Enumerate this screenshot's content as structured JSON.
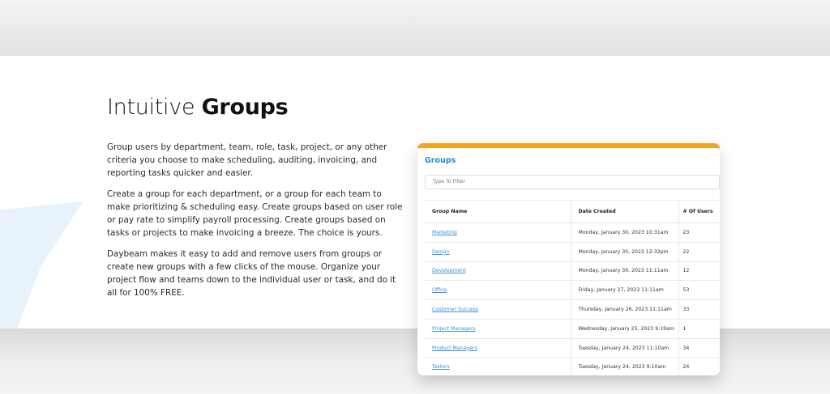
{
  "heading": {
    "light": "Intuitive",
    "bold": "Groups"
  },
  "paragraphs": [
    "Group users by department, team, role, task, project, or any other criteria you choose to make scheduling, auditing, invoicing, and reporting tasks quicker and easier.",
    "Create a group for each department, or a group for each team to make prioritizing & scheduling easy. Create groups based on user role or pay rate to simplify payroll processing. Create groups based on tasks or projects to make invoicing a breeze. The choice is yours.",
    "Daybeam makes it easy to add and remove users from groups or create new groups with a few clicks of the mouse. Organize your project flow and teams down to the individual user or task, and do it all for 100% FREE."
  ],
  "panel": {
    "title": "Groups",
    "filter_placeholder": "Type To Filter",
    "columns": [
      "Group Name",
      "Date Created",
      "# Of Users"
    ],
    "rows": [
      {
        "name": "Marketing",
        "date": "Monday, January 30, 2023 10:31am",
        "users": "23"
      },
      {
        "name": "Design",
        "date": "Monday, January 30, 2023 12:32pm",
        "users": "22"
      },
      {
        "name": "Development",
        "date": "Monday, January 30, 2023 11:11am",
        "users": "12"
      },
      {
        "name": "Office",
        "date": "Friday, January 27, 2023 11:11am",
        "users": "53"
      },
      {
        "name": "Customer Success",
        "date": "Thursday, January 26, 2023 11:11am",
        "users": "33"
      },
      {
        "name": "Project Managers",
        "date": "Wednesday, January 25, 2023 9:19am",
        "users": "1"
      },
      {
        "name": "Product Managers",
        "date": "Tuesday, January 24, 2023 11:10am",
        "users": "34"
      },
      {
        "name": "Testers",
        "date": "Tuesday, January 24, 2023 9:10am",
        "users": "24"
      }
    ]
  },
  "colors": {
    "accent": "#f2a51f",
    "link": "#3a8fd6",
    "title": "#2a88c9"
  }
}
